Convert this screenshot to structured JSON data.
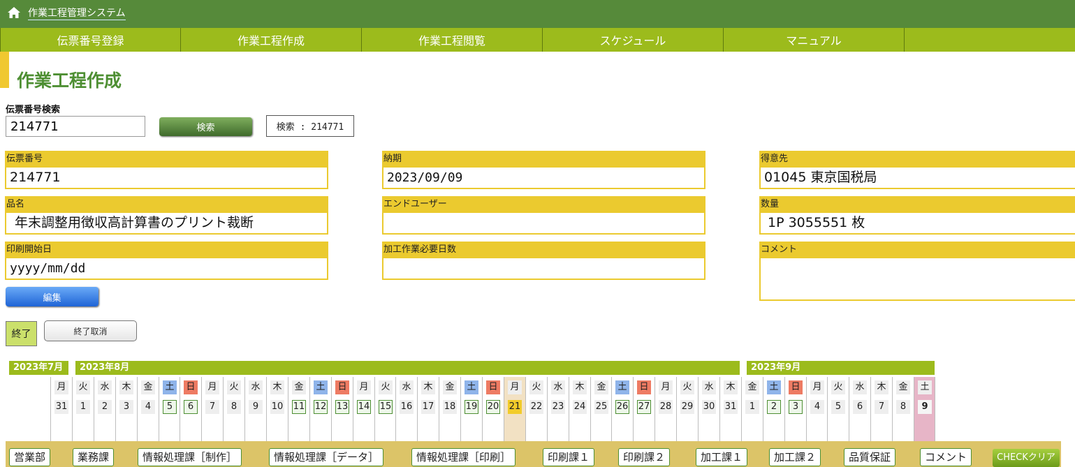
{
  "app": {
    "title": "作業工程管理システム"
  },
  "nav": {
    "items": [
      {
        "label": "伝票番号登録"
      },
      {
        "label": "作業工程作成"
      },
      {
        "label": "作業工程閲覧"
      },
      {
        "label": "スケジュール"
      },
      {
        "label": "マニュアル"
      }
    ]
  },
  "page": {
    "title": "作業工程作成"
  },
  "search": {
    "label": "伝票番号検索",
    "value": "214771",
    "button_label": "検索",
    "result": "検索 : 214771"
  },
  "form": {
    "slip_no": {
      "label": "伝票番号",
      "value": "214771"
    },
    "due_date": {
      "label": "納期",
      "value": "2023/09/09"
    },
    "customer": {
      "label": "得意先",
      "value": "01045 東京国税局"
    },
    "product": {
      "label": "品名",
      "value": "年末調整用徴収高計算書のプリント裁断"
    },
    "end_user": {
      "label": "エンドユーザー",
      "value": ""
    },
    "quantity": {
      "label": "数量",
      "value": "1P 3055551 枚"
    },
    "print_start": {
      "label": "印刷開始日",
      "value": "yyyy/mm/dd"
    },
    "processing_days": {
      "label": "加工作業必要日数",
      "value": ""
    },
    "comment": {
      "label": "コメント",
      "value": ""
    }
  },
  "actions": {
    "edit_label": "編集",
    "done_label": "終了",
    "undone_label": "終了取消"
  },
  "calendar": {
    "months": [
      {
        "label": "2023年7月"
      },
      {
        "label": "2023年8月"
      },
      {
        "label": "2023年9月"
      }
    ],
    "days": [
      {
        "dow": "月",
        "day": "31",
        "type": ""
      },
      {
        "dow": "火",
        "day": "1",
        "type": ""
      },
      {
        "dow": "水",
        "day": "2",
        "type": ""
      },
      {
        "dow": "木",
        "day": "3",
        "type": ""
      },
      {
        "dow": "金",
        "day": "4",
        "type": ""
      },
      {
        "dow": "土",
        "day": "5",
        "type": "sat"
      },
      {
        "dow": "日",
        "day": "6",
        "type": "sun"
      },
      {
        "dow": "月",
        "day": "7",
        "type": ""
      },
      {
        "dow": "火",
        "day": "8",
        "type": ""
      },
      {
        "dow": "水",
        "day": "9",
        "type": ""
      },
      {
        "dow": "木",
        "day": "10",
        "type": ""
      },
      {
        "dow": "金",
        "day": "11",
        "type": "hol"
      },
      {
        "dow": "土",
        "day": "12",
        "type": "sat"
      },
      {
        "dow": "日",
        "day": "13",
        "type": "sun"
      },
      {
        "dow": "月",
        "day": "14",
        "type": "hol"
      },
      {
        "dow": "火",
        "day": "15",
        "type": "hol"
      },
      {
        "dow": "水",
        "day": "16",
        "type": ""
      },
      {
        "dow": "木",
        "day": "17",
        "type": ""
      },
      {
        "dow": "金",
        "day": "18",
        "type": ""
      },
      {
        "dow": "土",
        "day": "19",
        "type": "sat"
      },
      {
        "dow": "日",
        "day": "20",
        "type": "sun"
      },
      {
        "dow": "月",
        "day": "21",
        "type": "today"
      },
      {
        "dow": "火",
        "day": "22",
        "type": ""
      },
      {
        "dow": "水",
        "day": "23",
        "type": ""
      },
      {
        "dow": "木",
        "day": "24",
        "type": ""
      },
      {
        "dow": "金",
        "day": "25",
        "type": ""
      },
      {
        "dow": "土",
        "day": "26",
        "type": "sat"
      },
      {
        "dow": "日",
        "day": "27",
        "type": "sun"
      },
      {
        "dow": "月",
        "day": "28",
        "type": ""
      },
      {
        "dow": "火",
        "day": "29",
        "type": ""
      },
      {
        "dow": "水",
        "day": "30",
        "type": ""
      },
      {
        "dow": "木",
        "day": "31",
        "type": ""
      },
      {
        "dow": "金",
        "day": "1",
        "type": ""
      },
      {
        "dow": "土",
        "day": "2",
        "type": "sat"
      },
      {
        "dow": "日",
        "day": "3",
        "type": "sun"
      },
      {
        "dow": "月",
        "day": "4",
        "type": ""
      },
      {
        "dow": "火",
        "day": "5",
        "type": ""
      },
      {
        "dow": "水",
        "day": "6",
        "type": ""
      },
      {
        "dow": "木",
        "day": "7",
        "type": ""
      },
      {
        "dow": "金",
        "day": "8",
        "type": ""
      },
      {
        "dow": "土",
        "day": "9",
        "type": "target"
      }
    ]
  },
  "departments": [
    {
      "label": "営業部"
    },
    {
      "label": "業務課"
    },
    {
      "label": "情報処理課［制作］"
    },
    {
      "label": "情報処理課［データ］"
    },
    {
      "label": "情報処理課［印刷］"
    },
    {
      "label": "印刷課１"
    },
    {
      "label": "印刷課２"
    },
    {
      "label": "加工課１"
    },
    {
      "label": "加工課２"
    },
    {
      "label": "品質保証"
    },
    {
      "label": "コメント"
    }
  ],
  "check_clear_label": "CHECKクリア",
  "colors": {
    "header": "#568a3a",
    "nav": "#9cbb1c",
    "field_border": "#ebca2f",
    "accent_green": "#4e8f33"
  }
}
